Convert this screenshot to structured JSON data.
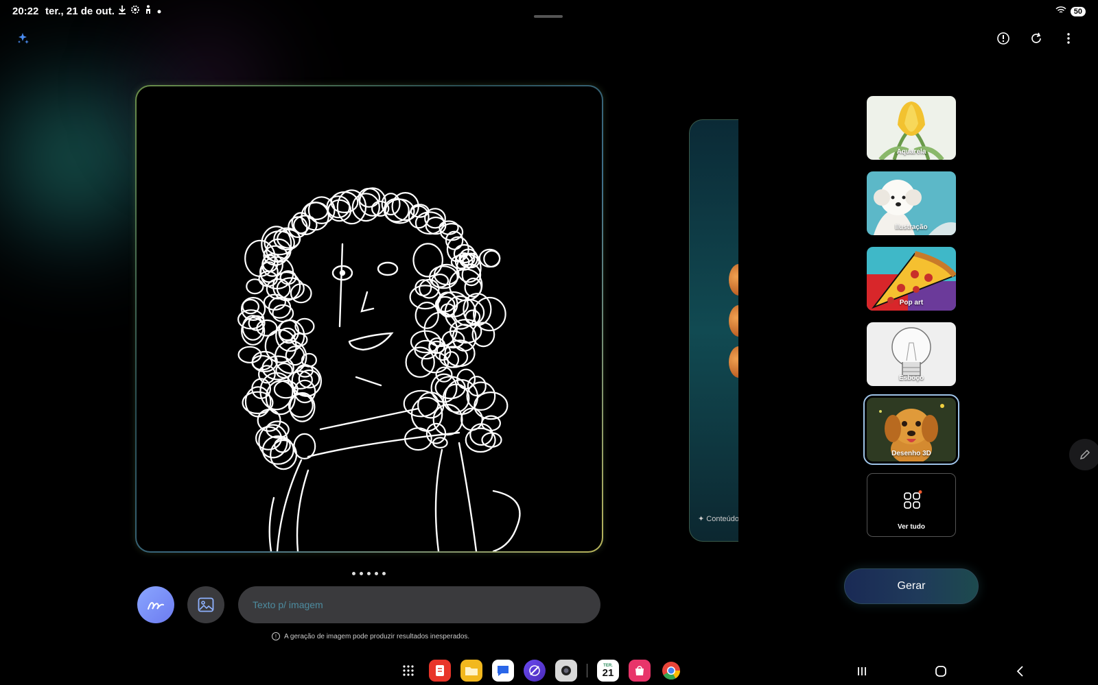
{
  "status": {
    "time": "20:22",
    "date": "ter., 21 de out.",
    "battery": "50",
    "icons": [
      "download-icon",
      "settings-icon",
      "accessibility-icon",
      "dot-icon"
    ]
  },
  "top_actions": [
    "ai-sparkle-icon",
    "info-icon",
    "refresh-icon",
    "more-icon"
  ],
  "carousel": {
    "next_card_label": "Conteúdo",
    "page_count": 5,
    "current_page": 1
  },
  "input": {
    "placeholder": "Texto p/ imagem",
    "value": ""
  },
  "disclaimer": "A geração de imagem pode produzir resultados inesperados.",
  "styles": [
    {
      "label": "Aquarela",
      "selected": false
    },
    {
      "label": "Ilustração",
      "selected": false
    },
    {
      "label": "Pop art",
      "selected": false
    },
    {
      "label": "Esboço",
      "selected": false
    },
    {
      "label": "Desenho 3D",
      "selected": true
    },
    {
      "label": "Ver tudo",
      "selected": false
    }
  ],
  "generate_label": "Gerar",
  "dock": {
    "apps": [
      "apps-grid-icon",
      "notes-app-icon",
      "files-app-icon",
      "messages-app-icon",
      "browser-app-icon",
      "camera-app-icon",
      "calendar-app-icon",
      "store-app-icon",
      "chrome-app-icon"
    ],
    "calendar_day": "21",
    "calendar_weekday": "TER."
  },
  "colors": {
    "accent": "#7b8cf5",
    "background": "#000000",
    "selected_outline": "#9fc4e8"
  }
}
